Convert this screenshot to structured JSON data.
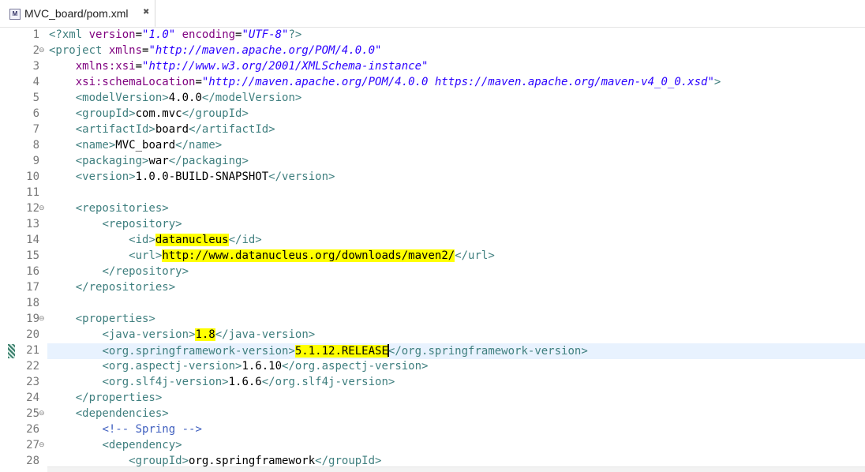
{
  "tab": {
    "title": "MVC_board/pom.xml",
    "icon_text": "M",
    "close_glyph": "✖",
    "icon": "maven-file-icon"
  },
  "editor": {
    "lines": [
      {
        "n": "1",
        "fold": "",
        "segs": [
          [
            "t",
            "<?xml "
          ],
          [
            "a",
            "version"
          ],
          [
            "",
            "="
          ],
          [
            "s",
            "\"1.0\""
          ],
          [
            "a",
            " encoding"
          ],
          [
            "",
            "="
          ],
          [
            "s",
            "\"UTF-8\""
          ],
          [
            "t",
            "?>"
          ]
        ]
      },
      {
        "n": "2",
        "fold": "⊖",
        "segs": [
          [
            "t",
            "<project "
          ],
          [
            "a",
            "xmlns"
          ],
          [
            "",
            "="
          ],
          [
            "s",
            "\"http://maven.apache.org/POM/4.0.0\""
          ]
        ]
      },
      {
        "n": "3",
        "fold": "",
        "segs": [
          [
            "",
            "    "
          ],
          [
            "a",
            "xmlns:xsi"
          ],
          [
            "",
            "="
          ],
          [
            "s",
            "\"http://www.w3.org/2001/XMLSchema-instance\""
          ]
        ]
      },
      {
        "n": "4",
        "fold": "",
        "segs": [
          [
            "",
            "    "
          ],
          [
            "a",
            "xsi:schemaLocation"
          ],
          [
            "",
            "="
          ],
          [
            "s",
            "\"http://maven.apache.org/POM/4.0.0 https://maven.apache.org/maven-v4_0_0.xsd\""
          ],
          [
            "t",
            ">"
          ]
        ]
      },
      {
        "n": "5",
        "fold": "",
        "segs": [
          [
            "",
            "    "
          ],
          [
            "t",
            "<modelVersion>"
          ],
          [
            "",
            "4.0.0"
          ],
          [
            "t",
            "</modelVersion>"
          ]
        ]
      },
      {
        "n": "6",
        "fold": "",
        "segs": [
          [
            "",
            "    "
          ],
          [
            "t",
            "<groupId>"
          ],
          [
            "",
            "com.mvc"
          ],
          [
            "t",
            "</groupId>"
          ]
        ]
      },
      {
        "n": "7",
        "fold": "",
        "segs": [
          [
            "",
            "    "
          ],
          [
            "t",
            "<artifactId>"
          ],
          [
            "",
            "board"
          ],
          [
            "t",
            "</artifactId>"
          ]
        ]
      },
      {
        "n": "8",
        "fold": "",
        "segs": [
          [
            "",
            "    "
          ],
          [
            "t",
            "<name>"
          ],
          [
            "",
            "MVC_board"
          ],
          [
            "t",
            "</name>"
          ]
        ]
      },
      {
        "n": "9",
        "fold": "",
        "segs": [
          [
            "",
            "    "
          ],
          [
            "t",
            "<packaging>"
          ],
          [
            "",
            "war"
          ],
          [
            "t",
            "</packaging>"
          ]
        ]
      },
      {
        "n": "10",
        "fold": "",
        "segs": [
          [
            "",
            "    "
          ],
          [
            "t",
            "<version>"
          ],
          [
            "",
            "1.0.0-BUILD-SNAPSHOT"
          ],
          [
            "t",
            "</version>"
          ]
        ]
      },
      {
        "n": "11",
        "fold": "",
        "segs": []
      },
      {
        "n": "12",
        "fold": "⊖",
        "segs": [
          [
            "",
            "    "
          ],
          [
            "t",
            "<repositories>"
          ]
        ]
      },
      {
        "n": "13",
        "fold": "",
        "segs": [
          [
            "",
            "        "
          ],
          [
            "t",
            "<repository>"
          ]
        ]
      },
      {
        "n": "14",
        "fold": "",
        "segs": [
          [
            "",
            "            "
          ],
          [
            "t",
            "<id>"
          ],
          [
            "hl",
            "datanucleus"
          ],
          [
            "t",
            "</id>"
          ]
        ]
      },
      {
        "n": "15",
        "fold": "",
        "segs": [
          [
            "",
            "            "
          ],
          [
            "t",
            "<url>"
          ],
          [
            "hl",
            "http://www.datanucleus.org/downloads/maven2/"
          ],
          [
            "t",
            "</url>"
          ]
        ]
      },
      {
        "n": "16",
        "fold": "",
        "segs": [
          [
            "",
            "        "
          ],
          [
            "t",
            "</repository>"
          ]
        ]
      },
      {
        "n": "17",
        "fold": "",
        "segs": [
          [
            "",
            "    "
          ],
          [
            "t",
            "</repositories>"
          ]
        ]
      },
      {
        "n": "18",
        "fold": "",
        "segs": []
      },
      {
        "n": "19",
        "fold": "⊖",
        "segs": [
          [
            "",
            "    "
          ],
          [
            "t",
            "<properties>"
          ]
        ]
      },
      {
        "n": "20",
        "fold": "",
        "segs": [
          [
            "",
            "        "
          ],
          [
            "t",
            "<java-version>"
          ],
          [
            "hl",
            "1.8"
          ],
          [
            "t",
            "</java-version>"
          ]
        ]
      },
      {
        "n": "21",
        "fold": "",
        "current": true,
        "marker": true,
        "segs": [
          [
            "",
            "        "
          ],
          [
            "t",
            "<org.springframework-version>"
          ],
          [
            "hl",
            "5.1.12.RELEASE"
          ],
          [
            "caret",
            ""
          ],
          [
            "t",
            "</org.springframework-version>"
          ]
        ]
      },
      {
        "n": "22",
        "fold": "",
        "segs": [
          [
            "",
            "        "
          ],
          [
            "t",
            "<org.aspectj-version>"
          ],
          [
            "",
            "1.6.10"
          ],
          [
            "t",
            "</org.aspectj-version>"
          ]
        ]
      },
      {
        "n": "23",
        "fold": "",
        "segs": [
          [
            "",
            "        "
          ],
          [
            "t",
            "<org.slf4j-version>"
          ],
          [
            "",
            "1.6.6"
          ],
          [
            "t",
            "</org.slf4j-version>"
          ]
        ]
      },
      {
        "n": "24",
        "fold": "",
        "segs": [
          [
            "",
            "    "
          ],
          [
            "t",
            "</properties>"
          ]
        ]
      },
      {
        "n": "25",
        "fold": "⊖",
        "segs": [
          [
            "",
            "    "
          ],
          [
            "t",
            "<dependencies>"
          ]
        ]
      },
      {
        "n": "26",
        "fold": "",
        "segs": [
          [
            "",
            "        "
          ],
          [
            "c",
            "<!-- Spring -->"
          ]
        ]
      },
      {
        "n": "27",
        "fold": "⊖",
        "segs": [
          [
            "",
            "        "
          ],
          [
            "t",
            "<dependency>"
          ]
        ]
      },
      {
        "n": "28",
        "fold": "",
        "segs": [
          [
            "",
            "            "
          ],
          [
            "t",
            "<groupId>"
          ],
          [
            "",
            "org.springframework"
          ],
          [
            "t",
            "</groupId>"
          ]
        ]
      }
    ]
  }
}
